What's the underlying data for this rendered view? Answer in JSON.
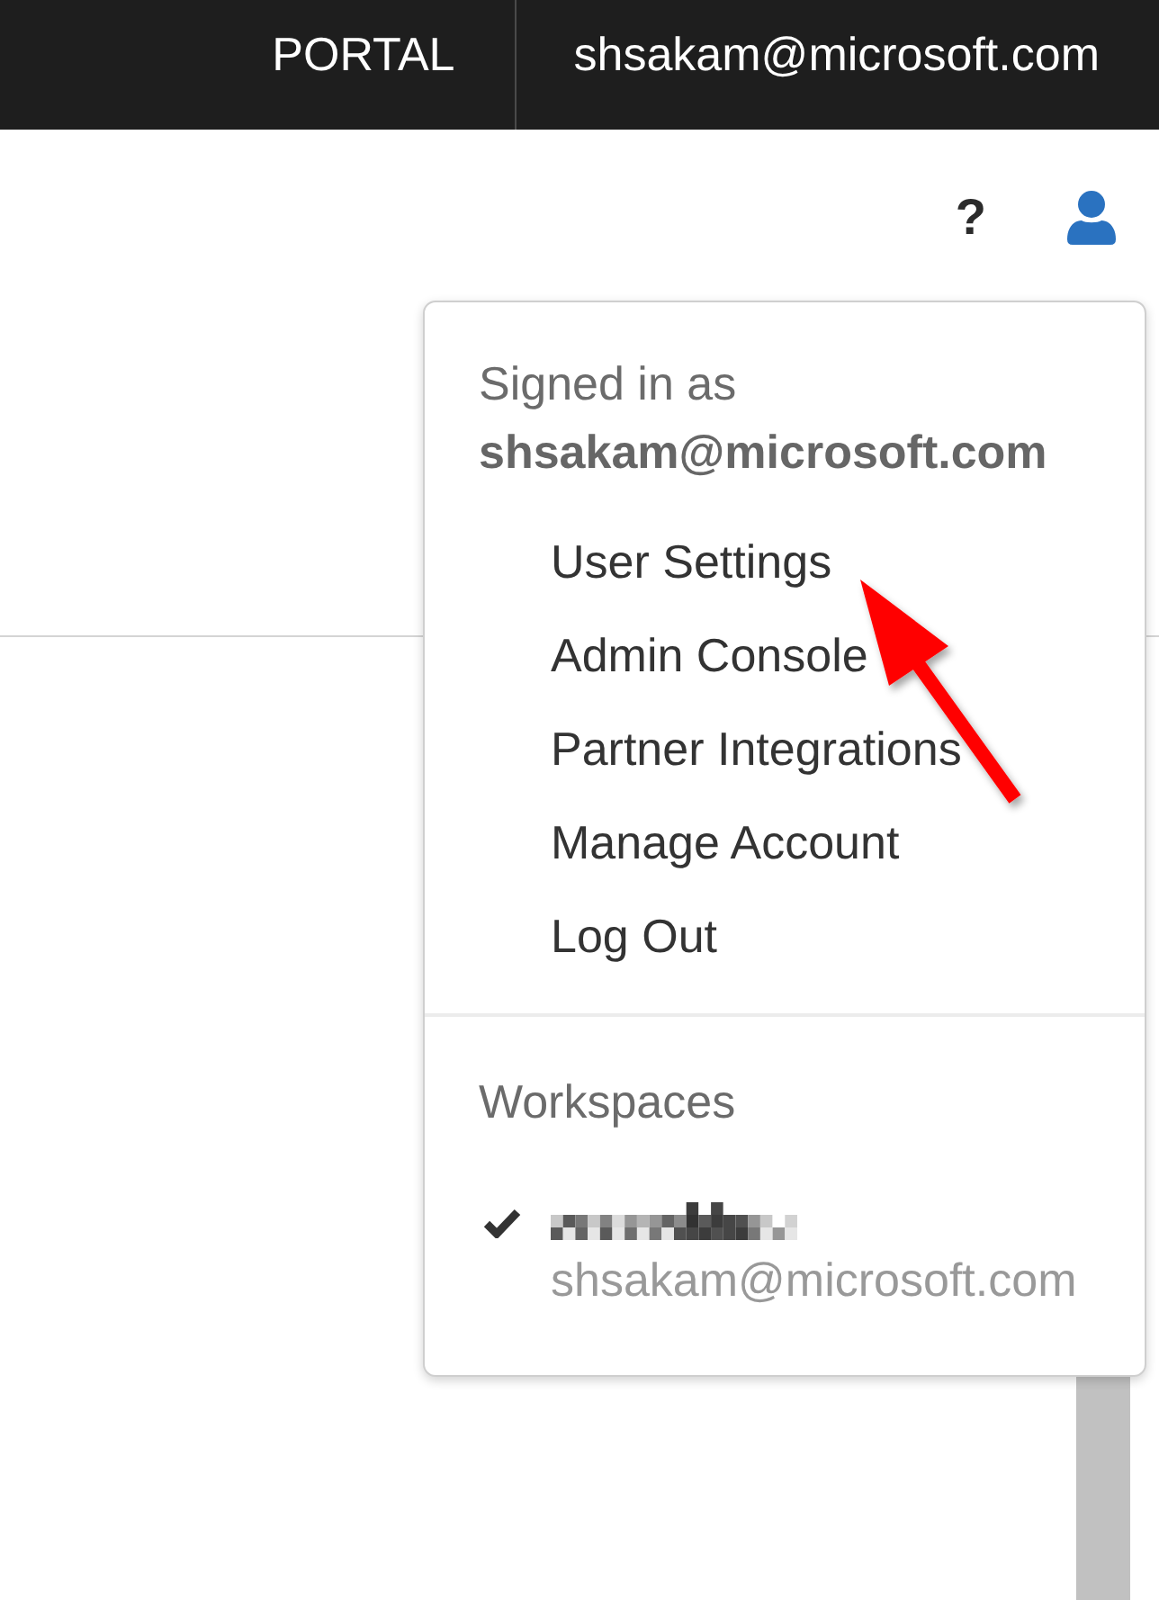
{
  "top_bar": {
    "links": [
      {
        "label": "PORTAL"
      },
      {
        "label": "shsakam@microsoft.com"
      }
    ]
  },
  "toolbar": {
    "help_label": "?"
  },
  "account_menu": {
    "signed_in_label": "Signed in as",
    "user_email": "shsakam@microsoft.com",
    "items": [
      {
        "label": "User Settings"
      },
      {
        "label": "Admin Console"
      },
      {
        "label": "Partner Integrations"
      },
      {
        "label": "Manage Account"
      },
      {
        "label": "Log Out"
      }
    ],
    "workspaces_title": "Workspaces",
    "workspaces": [
      {
        "selected": true,
        "email": "shsakam@microsoft.com"
      }
    ]
  }
}
